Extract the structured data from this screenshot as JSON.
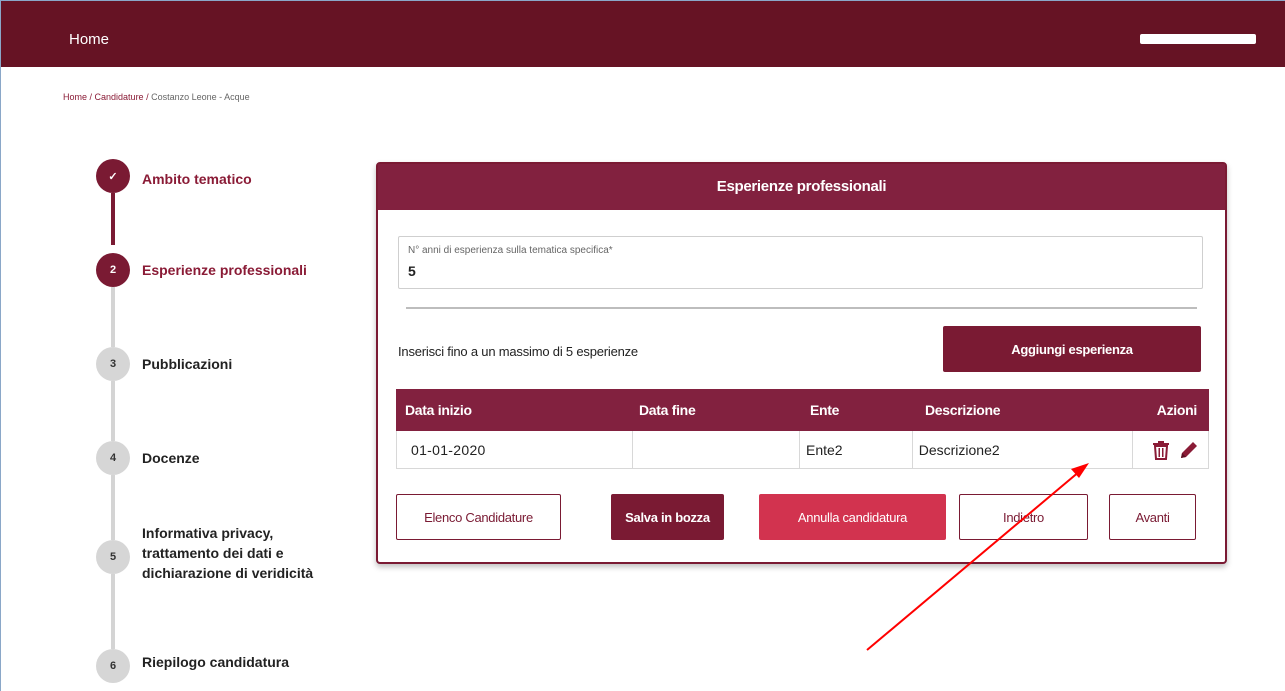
{
  "topbar": {
    "home_label": "Home"
  },
  "breadcrumb": {
    "home": "Home",
    "candidature": "Candidature",
    "current": "Costanzo Leone - Acque",
    "separator": " / "
  },
  "stepper": {
    "steps": [
      {
        "number": "✓",
        "label": "Ambito tematico",
        "state": "done"
      },
      {
        "number": "2",
        "label": "Esperienze professionali",
        "state": "active"
      },
      {
        "number": "3",
        "label": "Pubblicazioni",
        "state": "todo"
      },
      {
        "number": "4",
        "label": "Docenze",
        "state": "todo"
      },
      {
        "number": "5",
        "label_lines": [
          "Informativa privacy,",
          "trattamento dei dati e",
          "dichiarazione di veridicità"
        ],
        "state": "todo"
      },
      {
        "number": "6",
        "label": "Riepilogo candidatura",
        "state": "todo"
      }
    ]
  },
  "card": {
    "title": "Esperienze professionali",
    "years_field": {
      "label": "N° anni di esperienza sulla tematica specifica*",
      "value": "5"
    },
    "hint": "Inserisci fino a un massimo di 5 esperienze",
    "add_button": "Aggiungi esperienza",
    "table": {
      "headers": [
        "Data inizio",
        "Data fine",
        "Ente",
        "Descrizione",
        "Azioni"
      ],
      "rows": [
        {
          "data_inizio": "01-01-2020",
          "data_fine": "",
          "ente": "Ente2",
          "descrizione": "Descrizione2",
          "actions": [
            "trash-icon",
            "pencil-icon"
          ]
        }
      ]
    },
    "buttons": {
      "elenco": "Elenco Candidature",
      "salva": "Salva in bozza",
      "annulla": "Annulla candidatura",
      "indietro": "Indietro",
      "avanti": "Avanti"
    }
  },
  "colors": {
    "brand": "#661324",
    "header": "#82213f",
    "danger": "#d2334f",
    "annotation_arrow": "#ff0000"
  }
}
